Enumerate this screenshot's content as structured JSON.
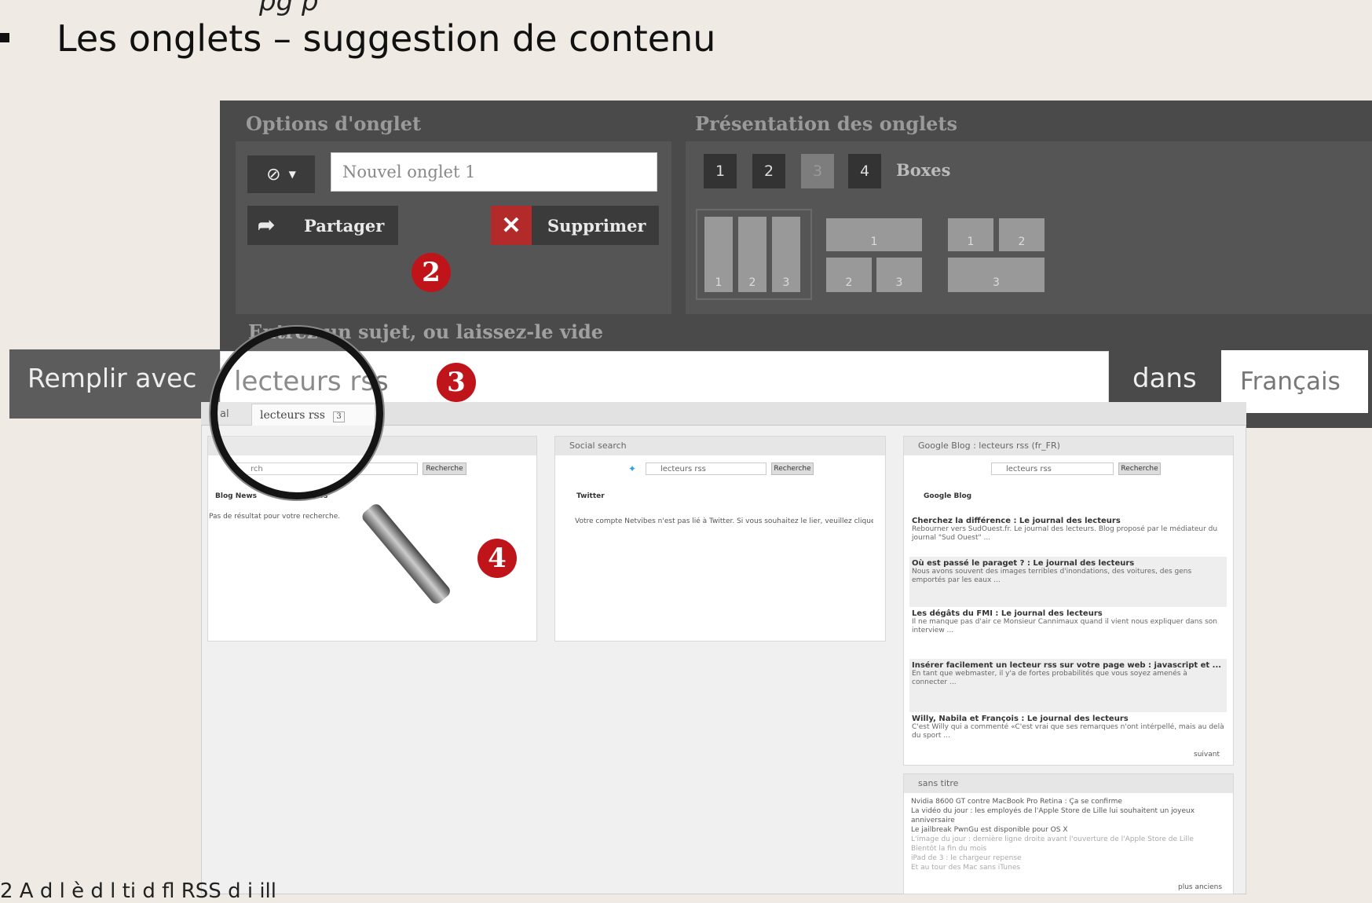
{
  "slide": {
    "top_fragment": "pg p",
    "heading": "Les onglets – suggestion de contenu",
    "footer": "2          A     d l è  d  l    ti   d  fl   RSS     d  i            ill"
  },
  "tab_options": {
    "title": "Options d'onglet",
    "icon_select": "⊘",
    "tab_name_placeholder": "Nouvel onglet 1",
    "share_label": "Partager",
    "delete_label": "Supprimer"
  },
  "tab_presentation": {
    "title": "Présentation des onglets",
    "columns": [
      "1",
      "2",
      "3",
      "4"
    ],
    "selected_columns": "3",
    "rows_label": "Boxes",
    "layouts": [
      {
        "boxes": [
          "1",
          "2",
          "3"
        ]
      },
      {
        "boxes": [
          "1",
          "2",
          "3"
        ]
      },
      {
        "boxes": [
          "1",
          "2",
          "3"
        ]
      }
    ]
  },
  "subject_label": "Entrez un sujet, ou laissez-le vide",
  "fill": {
    "label": "Remplir avec",
    "query": "lecteurs rss",
    "in_label": "dans",
    "language": "Français"
  },
  "badges": {
    "two": "2",
    "three": "3",
    "four": "4"
  },
  "tabs": {
    "left": "al",
    "active": "lecteurs rss",
    "count": "3"
  },
  "widgets": {
    "w1": {
      "search_placeholder": "rch",
      "search_btn": "Recherche",
      "tabs": [
        "Blog News",
        "News"
      ],
      "message": "Pas de résultat pour votre recherche."
    },
    "w2": {
      "title": "Social search",
      "query": "lecteurs rss",
      "search_btn": "Recherche",
      "tab": "Twitter",
      "message": "Votre compte Netvibes n'est pas lié à Twitter. Si vous souhaitez le lier, veuillez cliquer ici"
    },
    "w3": {
      "title": "Google Blog : lecteurs rss (fr_FR)",
      "query": "lecteurs rss",
      "search_btn": "Recherche",
      "tab": "Google Blog",
      "items": [
        {
          "title": "Cherchez la différence : Le journal des lecteurs",
          "body": "Rebourner vers SudOuest.fr. Le journal des lecteurs. Blog proposé par le médiateur du journal \"Sud Ouest\" ..."
        },
        {
          "title": "Où est passé le paraget ? : Le journal des lecteurs",
          "body": "Nous avons souvent des images terribles d'inondations, des voitures, des gens emportés par les eaux ..."
        },
        {
          "title": "Les dégâts du FMI : Le journal des lecteurs",
          "body": "Il ne manque pas d'air ce Monsieur Cannimaux quand il vient nous expliquer dans son interview ..."
        },
        {
          "title": "Insérer facilement un lecteur rss sur votre page web : javascript et ...",
          "body": "En tant que webmaster, il y'a de fortes probabilités que vous soyez amenés à connecter ..."
        },
        {
          "title": "Willy, Nabila et François : Le journal des lecteurs",
          "body": "C'est Willy qui a commenté «C'est vrai que ses remarques n'ont intérpellé, mais au delà du sport ..."
        }
      ],
      "more": "suivant"
    },
    "w4": {
      "title": "sans titre",
      "items": [
        "Nvidia 8600 GT contre MacBook Pro Retina : Ça se confirme",
        "La vidéo du jour : les employés de l'Apple Store de Lille lui souhaitent un joyeux anniversaire",
        "Le jailbreak PwnGu est disponible pour OS X",
        "L'image du jour : dernière ligne droite avant l'ouverture de l'Apple Store de Lille",
        "Bientôt la fin du mois",
        "iPad de 3 : le chargeur repense",
        "Et au tour des Mac sans iTunes"
      ],
      "more": "plus anciens"
    }
  }
}
